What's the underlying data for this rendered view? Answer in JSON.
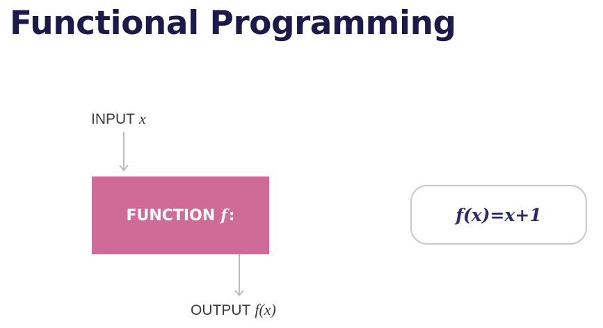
{
  "title": "Functional Programming",
  "diagram": {
    "input": {
      "label": "INPUT",
      "var": "x"
    },
    "function_box": {
      "label": "FUNCTION",
      "var": "f",
      "suffix": ":"
    },
    "output": {
      "label": "OUTPUT",
      "var": "f(x)"
    },
    "formula": "f(x)=x+1",
    "colors": {
      "title": "#1c1a4a",
      "function_box": "#d06a96",
      "formula_text": "#2c2a6e",
      "formula_border": "#c8c8c8",
      "arrow": "#bdbdbd"
    }
  }
}
